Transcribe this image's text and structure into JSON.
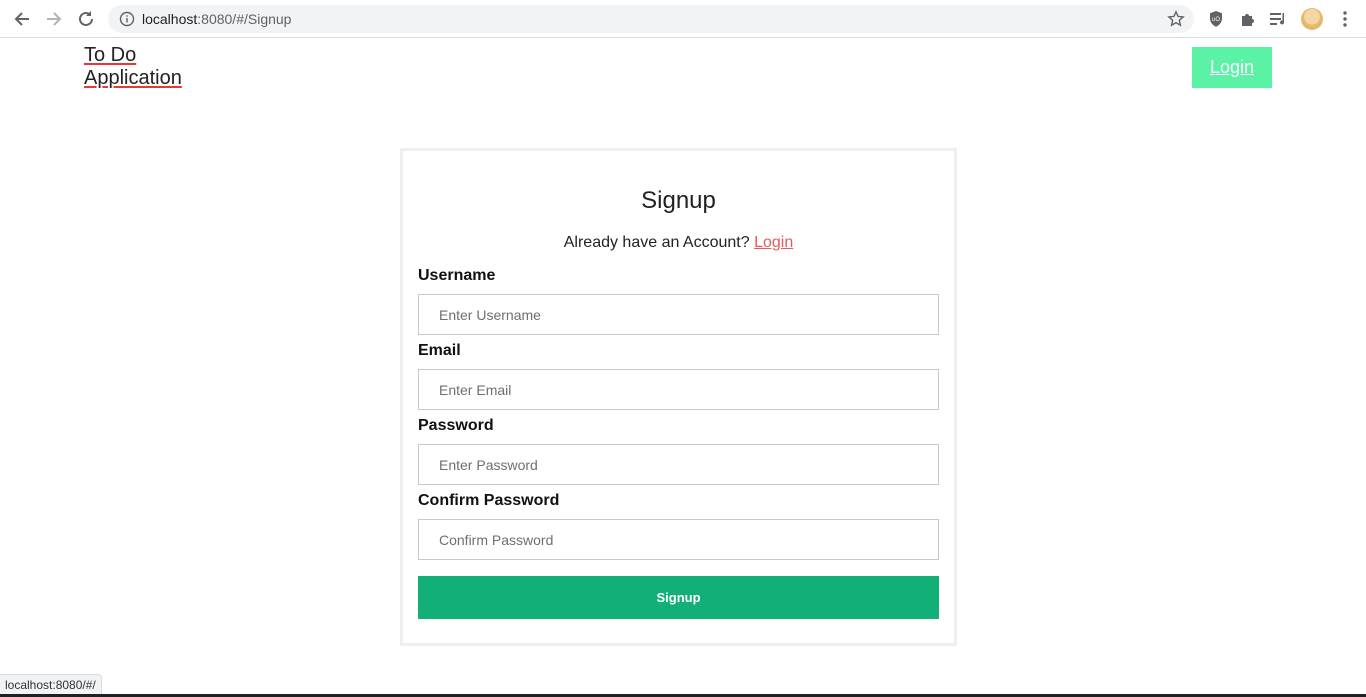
{
  "browser": {
    "url_host": "localhost",
    "url_rest": ":8080/#/Signup",
    "status_url": "localhost:8080/#/"
  },
  "header": {
    "brand_line1": "To Do",
    "brand_line2": "Application",
    "login_button": "Login"
  },
  "signup": {
    "title": "Signup",
    "subtitle": "Already have an Account?",
    "login_link": "Login",
    "fields": [
      {
        "label": "Username",
        "placeholder": "Enter Username"
      },
      {
        "label": "Email",
        "placeholder": "Enter Email"
      },
      {
        "label": "Password",
        "placeholder": "Enter Password"
      },
      {
        "label": "Confirm Password",
        "placeholder": "Confirm Password"
      }
    ],
    "submit_label": "Signup"
  },
  "colors": {
    "accent_green": "#5af2a5",
    "submit_green": "#12b076",
    "link_red": "#e8585c"
  }
}
